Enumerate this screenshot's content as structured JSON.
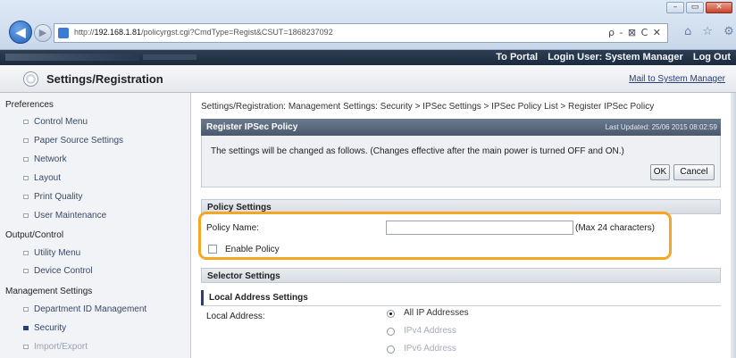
{
  "browser": {
    "url_prefix": "http://",
    "url_host": "192.168.1.81",
    "url_path": "/policyrgst.cgi?CmdType=Regist&CSUT=1868237092",
    "url_tools": "ρ - ⊠ C ✕",
    "toolbar_icons": "⌂ ☆ ⚙",
    "window_min": "–",
    "window_max": "▭",
    "window_close": "✕"
  },
  "topbar": {
    "portal_link": "To Portal",
    "login_user": "Login User: System Manager",
    "logout_link": "Log Out"
  },
  "header": {
    "title": "Settings/Registration",
    "mail_link": "Mail to System Manager"
  },
  "sidebar": {
    "groups": [
      "Preferences",
      "Output/Control",
      "Management Settings"
    ],
    "preferences_items": [
      "Control Menu",
      "Paper Source Settings",
      "Network",
      "Layout",
      "Print Quality",
      "User Maintenance"
    ],
    "output_items": [
      "Utility Menu",
      "Device Control"
    ],
    "management_items": [
      "Department ID Management",
      "Security",
      "Import/Export"
    ]
  },
  "main": {
    "breadcrumb": "Settings/Registration: Management Settings: Security > IPSec Settings > IPSec Policy List > Register IPSec Policy",
    "panel_title": "Register IPSec Policy",
    "last_updated": "Last Updated: 25/06 2015 08:02:59",
    "message": "The settings will be changed as follows. (Changes effective after the main power is turned OFF and ON.)",
    "ok_label": "OK",
    "cancel_label": "Cancel",
    "policy_settings_title": "Policy Settings",
    "policy_name_label": "Policy Name:",
    "policy_name_value": "",
    "policy_name_hint": "(Max 24 characters)",
    "enable_policy_label": "Enable Policy",
    "enable_policy_checked": false,
    "selector_settings_title": "Selector Settings",
    "local_address_settings_title": "Local Address Settings",
    "local_address_label": "Local Address:",
    "local_address_options": [
      "All IP Addresses",
      "IPv4 Address",
      "IPv6 Address"
    ],
    "local_address_selected": "All IP Addresses"
  },
  "colors": {
    "highlight": "#f5a623",
    "panel_header": "#4a586d",
    "link": "#2a3f7a"
  }
}
